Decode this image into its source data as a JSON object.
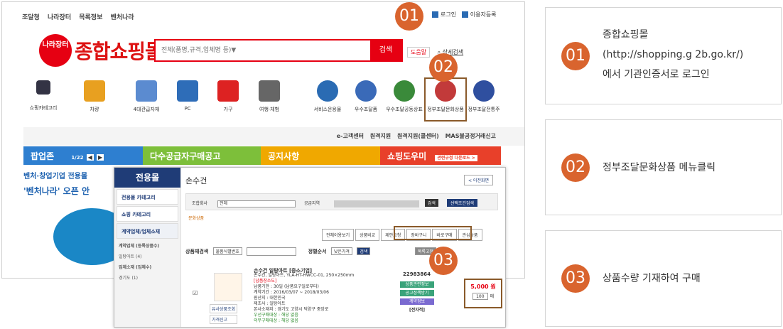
{
  "top_links": [
    "조달청",
    "나라장터",
    "목록정보",
    "벤처나라"
  ],
  "login": {
    "label": "로그인",
    "register": "이용자등록"
  },
  "logo": {
    "badge": "나라장터",
    "text": "종합쇼핑몰"
  },
  "search": {
    "placeholder": "전체(품명,규격,업체명 등)▼",
    "button": "검색",
    "help": "도움말",
    "advanced": "상세검색"
  },
  "categories": [
    {
      "label": "쇼핑카테고리",
      "color": "#334"
    },
    {
      "label": "차량",
      "color": "#e8a020"
    },
    {
      "label": "4대관급자재",
      "color": "#5b8bd0"
    },
    {
      "label": "PC",
      "color": "#2e6db8"
    },
    {
      "label": "가구",
      "color": "#d22"
    },
    {
      "label": "여행·체험",
      "color": "#666"
    },
    {
      "label": "서비스운용물",
      "color": "#2a6bb3"
    },
    {
      "label": "우수조달품",
      "color": "#3a6ab8"
    },
    {
      "label": "우수조달공동상표",
      "color": "#3a8a3a"
    },
    {
      "label": "정부조달문화상품",
      "color": "#c23a3a"
    },
    {
      "label": "정부조달전통주",
      "color": "#2f4f9f"
    }
  ],
  "gray_links": "e-고객센터  원격지원  원격지원(콜센터)  MAS불공정거래신고",
  "bars": [
    {
      "label": "팝업존",
      "extra": "1/22",
      "color": "#2e7fd0"
    },
    {
      "label": "다수공급자구매공고",
      "color": "#7dbf3a"
    },
    {
      "label": "공지사항",
      "color": "#f0a800"
    },
    {
      "label": "쇼핑도우미",
      "extra": "관련규정 다운로드 >",
      "color": "#e8402a"
    }
  ],
  "left_text": [
    "벤처·창업기업 전용몰",
    "'벤처나라' 오픈 안"
  ],
  "sub": {
    "side_title": "전용몰",
    "side_items": [
      "전용몰 카테고리",
      "쇼핑 카테고리",
      "계약업체/업체소재"
    ],
    "side_small": [
      "계약업체 (등록상품수)",
      "일탕아트 (4)",
      "업체소재 (업체수)",
      "경기도 (1)"
    ],
    "title": "손수건",
    "back": "< 이전화면",
    "filter_label1": "조합회사",
    "filter_value1": "전체",
    "filter_label2": "공급지역",
    "filter_btn1": "검색",
    "filter_btn2": "선택조건검색",
    "cultural": "문화상품",
    "tabs": [
      "전체이용보기",
      "상품비교",
      "제안요청",
      "장바구니",
      "바로구매",
      "관심상품"
    ],
    "sort_label": "상품재검색",
    "sort_select": "물품식별번호",
    "sort_label2": "정렬순서",
    "sort_value2": "낮은가격",
    "sort_btn": "검색",
    "sort_btn2": "목록고정",
    "product_name": "손수건 일탕아트 [중소기업]",
    "product_lines": [
      "손수건, 일탕아트, YLA-HT-HWCC-01, 250×250mm",
      "[납품장소도]",
      "납품기한 : 30일 (납품요구일로부터)",
      "계약기간 : 2016/03/07 ~ 2018/03/06",
      "원산지 : 대한민국",
      "제조사 : 일탕아트",
      "본사소재지 : 경기도 고양시 덕양구 중앙로",
      "우선구매대상 : 해당 없음",
      "의무구매대상 : 해당 없음"
    ],
    "thumb_btns": [
      "유사상품조회",
      "가격신고"
    ],
    "code": "22983864",
    "green_btns": [
      "상품관련정보",
      "공고정책방기",
      "계약정보"
    ],
    "vendor": "[전자적]",
    "price": "5,000 원",
    "qty": "100",
    "qty_unit": "매"
  },
  "steps": [
    {
      "num": "01",
      "lines": [
        "종합쇼핑몰",
        "(http://shopping.g 2b.go.kr/)",
        "에서 기관인증서로 로그인"
      ]
    },
    {
      "num": "02",
      "lines": [
        "정부조달문화상품 메뉴클릭"
      ]
    },
    {
      "num": "03",
      "lines": [
        "상품수량 기재하여 구매"
      ]
    }
  ]
}
